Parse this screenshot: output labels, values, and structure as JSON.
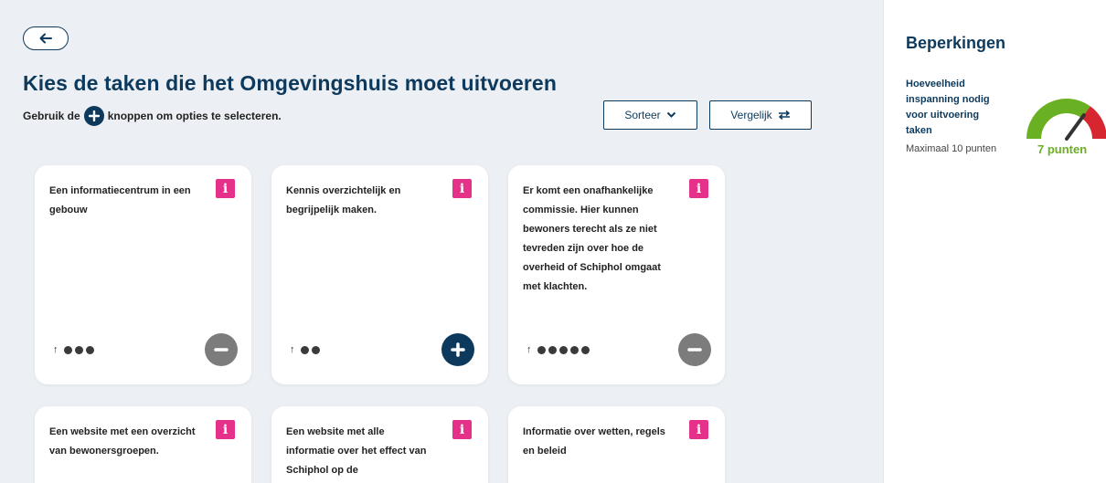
{
  "main": {
    "title": "Kies de taken die het Omgevingshuis moet uitvoeren",
    "instruction_before": "Gebruik de",
    "instruction_after": "knoppen om opties te selecteren.",
    "sort_label": "Sorteer",
    "compare_label": "Vergelijk"
  },
  "cards": [
    {
      "text": "Een informatiecentrum in een gebouw",
      "effort": 3,
      "selected": true
    },
    {
      "text": "Kennis overzichtelijk en begrijpelijk maken.",
      "effort": 2,
      "selected": false
    },
    {
      "text": "Er komt een onafhankelijke commissie. Hier kunnen bewoners terecht als ze niet tevreden zijn over hoe de overheid of Schiphol omgaat met klachten.",
      "effort": 5,
      "selected": true
    },
    {
      "text": "Een website met een overzicht van bewonersgroepen.",
      "effort": null,
      "selected": null
    },
    {
      "text": "Een website met alle informatie over het effect van Schiphol op de",
      "effort": null,
      "selected": null
    },
    {
      "text": "Informatie over wetten, regels en beleid",
      "effort": null,
      "selected": null
    }
  ],
  "sidebar": {
    "title": "Beperkingen",
    "limit_label": "Hoeveelheid inspanning nodig voor uitvoering taken",
    "limit_max": "Maximaal 10 punten",
    "gauge_value": 7,
    "gauge_max": 10,
    "gauge_text": "7 punten"
  },
  "colors": {
    "navy": "#0d3a5c",
    "info_pink": "#e6318a",
    "gauge_green": "#6ab023",
    "gauge_red": "#d6262f",
    "minus_grey": "#7c7c7c"
  },
  "icons": {
    "back": "arrow-left-icon",
    "sort": "chevron-down-icon",
    "compare": "swap-arrows-icon",
    "info": "info-icon",
    "add": "plus-circle-icon",
    "remove": "minus-circle-icon",
    "effort": "arrow-up-icon"
  }
}
